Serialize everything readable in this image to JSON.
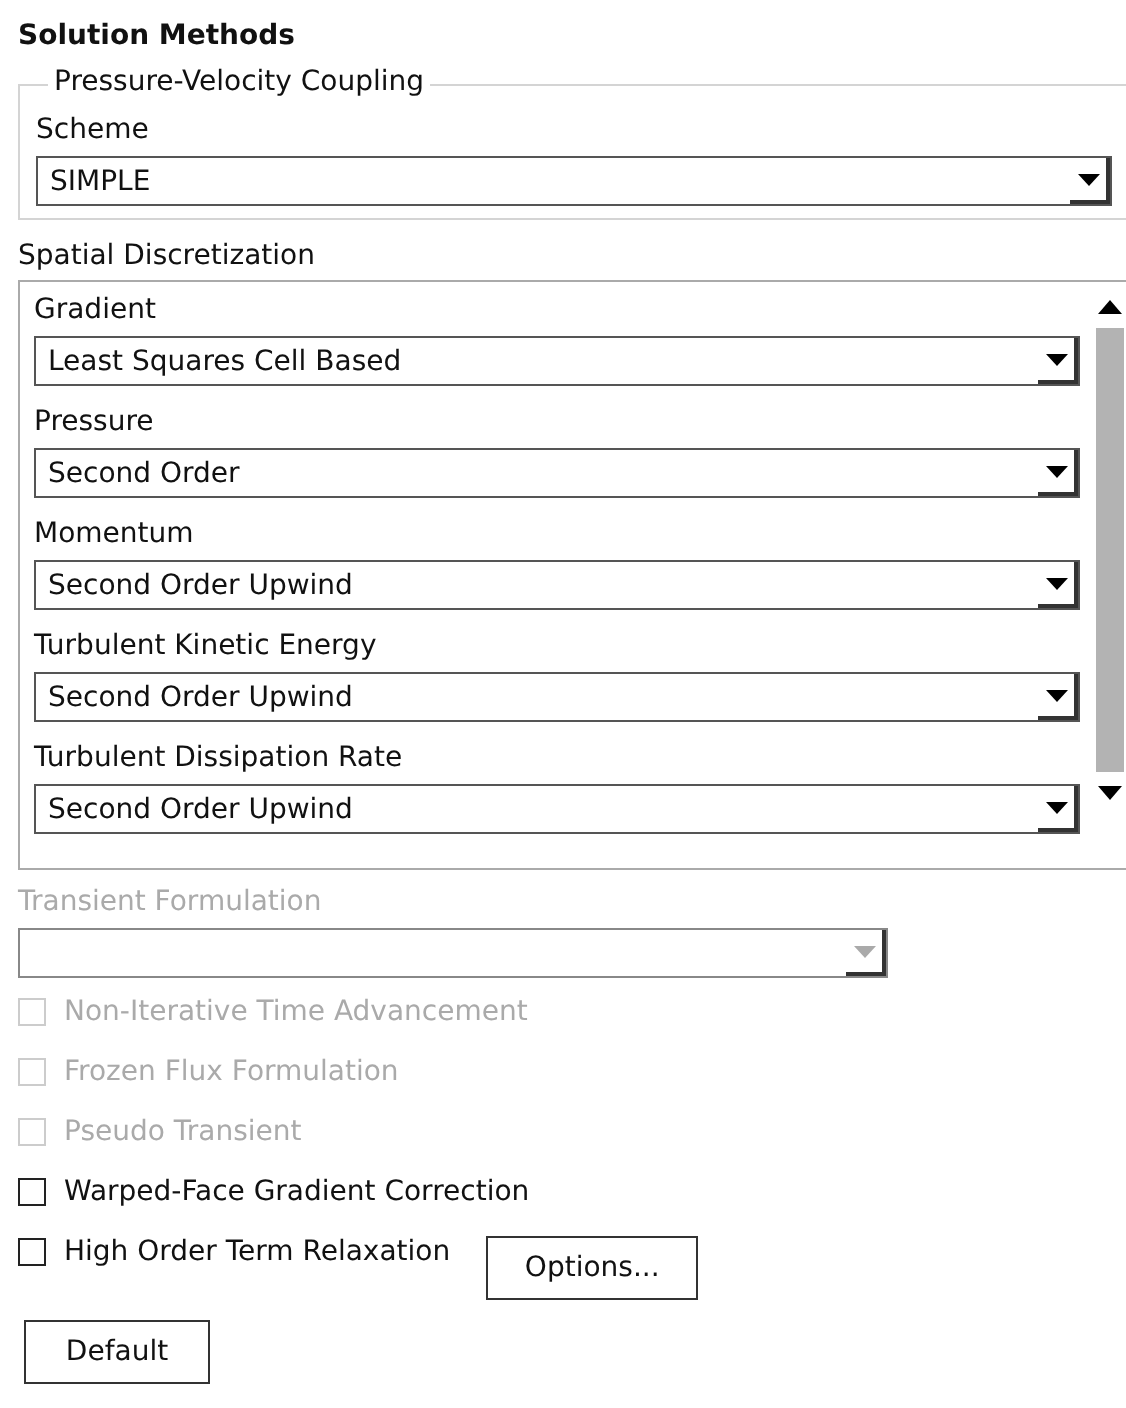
{
  "title": "Solution Methods",
  "coupling": {
    "legend": "Pressure-Velocity Coupling",
    "label": "Scheme",
    "value": "SIMPLE"
  },
  "spatial": {
    "title": "Spatial Discretization",
    "items": [
      {
        "label": "Gradient",
        "value": "Least Squares Cell Based"
      },
      {
        "label": "Pressure",
        "value": "Second Order"
      },
      {
        "label": "Momentum",
        "value": "Second Order Upwind"
      },
      {
        "label": "Turbulent Kinetic Energy",
        "value": "Second Order Upwind"
      },
      {
        "label": "Turbulent Dissipation Rate",
        "value": "Second Order Upwind"
      }
    ]
  },
  "transient": {
    "label": "Transient Formulation",
    "disabled": true
  },
  "checkboxes": [
    {
      "label": "Non-Iterative Time Advancement",
      "checked": false,
      "disabled": true
    },
    {
      "label": "Frozen Flux Formulation",
      "checked": false,
      "disabled": true
    },
    {
      "label": "Pseudo Transient",
      "checked": false,
      "disabled": true
    },
    {
      "label": "Warped-Face Gradient Correction",
      "checked": false,
      "disabled": false
    },
    {
      "label": "High Order Term Relaxation",
      "checked": false,
      "disabled": false,
      "button": "Options..."
    }
  ],
  "default_button": "Default"
}
